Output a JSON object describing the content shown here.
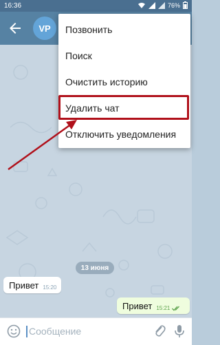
{
  "status_bar": {
    "time": "16:36",
    "battery": "76%"
  },
  "header": {
    "avatar_initials": "VP"
  },
  "menu": {
    "items": [
      {
        "label": "Позвонить"
      },
      {
        "label": "Поиск"
      },
      {
        "label": "Очистить историю"
      },
      {
        "label": "Удалить чат"
      },
      {
        "label": "Отключить уведомления"
      }
    ],
    "highlighted_index": 3
  },
  "chat": {
    "date_label": "13 июня",
    "messages": [
      {
        "text": "Привет",
        "time": "15:20",
        "direction": "incoming"
      },
      {
        "text": "Привет",
        "time": "15:21",
        "direction": "outgoing",
        "read": true
      }
    ]
  },
  "compose": {
    "placeholder": "Сообщение"
  },
  "colors": {
    "header": "#5682a3",
    "status_bar": "#4a6f90",
    "annotation": "#b0101a",
    "outgoing_bubble": "#effdde"
  }
}
